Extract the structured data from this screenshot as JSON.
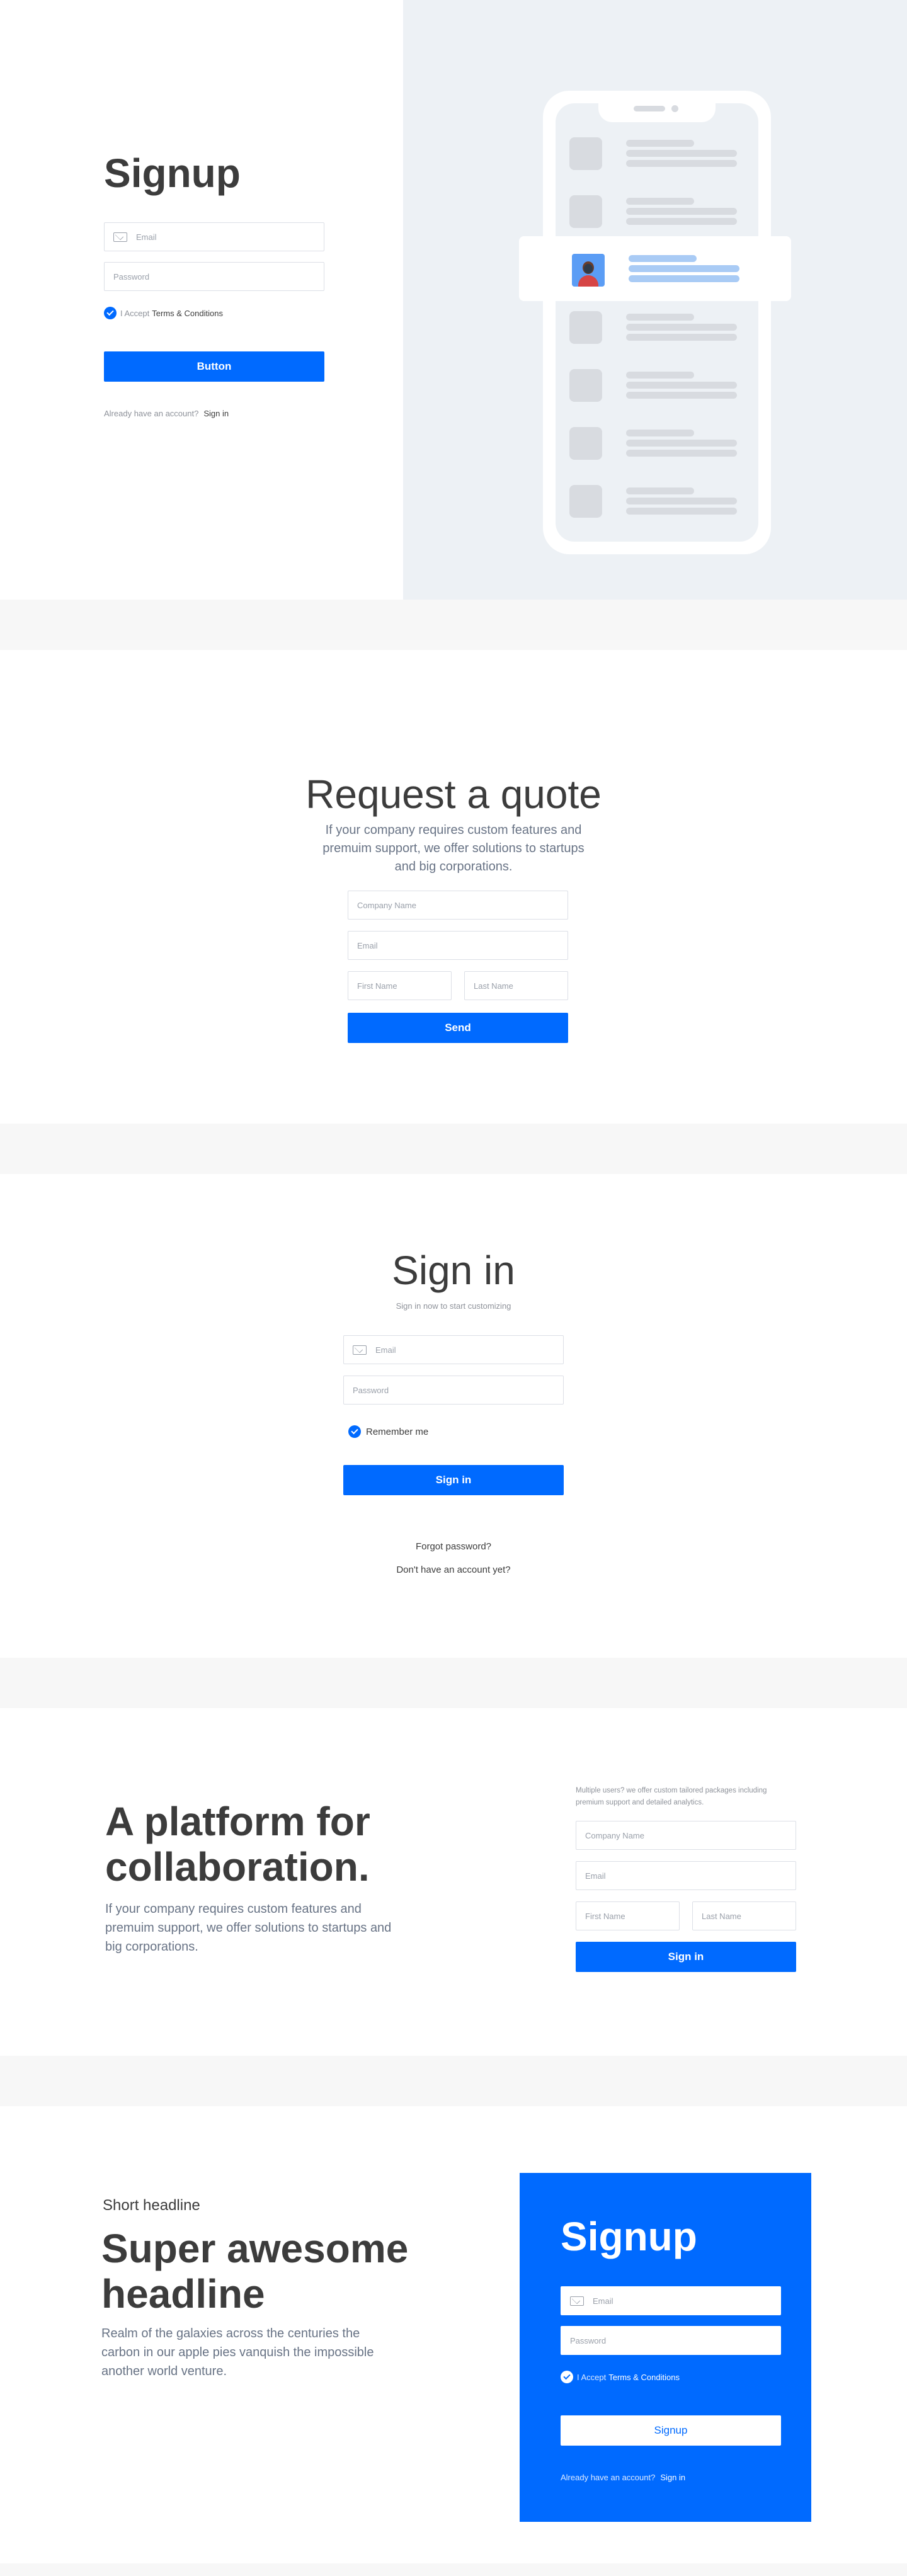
{
  "signup1": {
    "title": "Signup",
    "email_placeholder": "Email",
    "password_placeholder": "Password",
    "accept_text": "I Accept",
    "terms_link": "Terms & Conditions",
    "button": "Button",
    "already": "Already have an account?",
    "signin_link": "Sign in"
  },
  "quote": {
    "title": "Request a quote",
    "subtitle": "If your company requires custom features and premuim support, we offer solutions to startups and big corporations.",
    "company_placeholder": "Company Name",
    "email_placeholder": "Email",
    "first_placeholder": "First Name",
    "last_placeholder": "Last Name",
    "button": "Send"
  },
  "signin": {
    "title": "Sign in",
    "subtitle": "Sign in now to start customizing",
    "email_placeholder": "Email",
    "password_placeholder": "Password",
    "remember": "Remember me",
    "button": "Sign in",
    "forgot": "Forgot password?",
    "no_account": "Don't have an account yet?"
  },
  "platform": {
    "title_line1": "A platform for",
    "title_line2": "collaboration.",
    "subtitle": "If your company requires custom features and premuim support, we offer solutions to startups and big corporations.",
    "note": "Multiple users? we offer custom tailored packages including premium support and detailed analytics.",
    "company_placeholder": "Company Name",
    "email_placeholder": "Email",
    "first_placeholder": "First Name",
    "last_placeholder": "Last Name",
    "button": "Sign in"
  },
  "hero": {
    "eyebrow": "Short headline",
    "title_line1": "Super awesome",
    "title_line2": "headline",
    "subtitle": "Realm of the galaxies across the centuries the carbon in our apple pies vanquish the impossible another world venture."
  },
  "signup2": {
    "title": "Signup",
    "email_placeholder": "Email",
    "password_placeholder": "Password",
    "accept_text": "I Accept",
    "terms_link": "Terms & Conditions",
    "button": "Signup",
    "already": "Already have an account?",
    "signin_link": "Sign in"
  },
  "colors": {
    "primary": "#006aff",
    "panel_bg": "#edf1f5",
    "page_gap": "#f7f7f7"
  },
  "icons": [
    "mail-icon",
    "check-icon",
    "phone-illustration"
  ]
}
